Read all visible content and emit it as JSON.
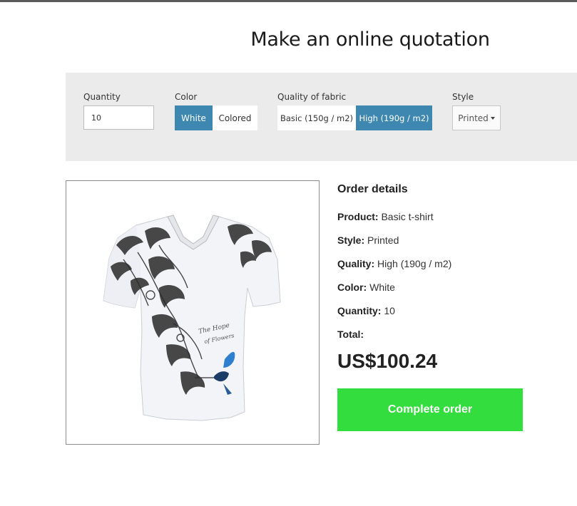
{
  "page_title": "Make an online quotation",
  "config": {
    "quantity_label": "Quantity",
    "quantity_value": "10",
    "color_label": "Color",
    "color_options": [
      "White",
      "Colored"
    ],
    "color_selected": "White",
    "quality_label": "Quality of fabric",
    "quality_options": [
      "Basic (150g / m2)",
      "High (190g / m2)"
    ],
    "quality_selected": "High (190g / m2)",
    "style_label": "Style",
    "style_value": "Printed"
  },
  "order": {
    "title": "Order details",
    "product_key": "Product:",
    "product_value": "Basic t-shirt",
    "style_key": "Style:",
    "style_value": "Printed",
    "quality_key": "Quality:",
    "quality_value": "High (190g / m2)",
    "color_key": "Color:",
    "color_value": "White",
    "quantity_key": "Quantity:",
    "quantity_value": "10",
    "total_key": "Total:",
    "total_value": "US$100.24"
  },
  "actions": {
    "complete_order": "Complete order"
  },
  "colors": {
    "active_option": "#3d87b0",
    "panel_background": "#ebebeb",
    "complete_button": "#33dd3d",
    "hummingbird_blue": "#2f7fd0"
  },
  "icons": {
    "style_dropdown": "caret-down-icon"
  }
}
